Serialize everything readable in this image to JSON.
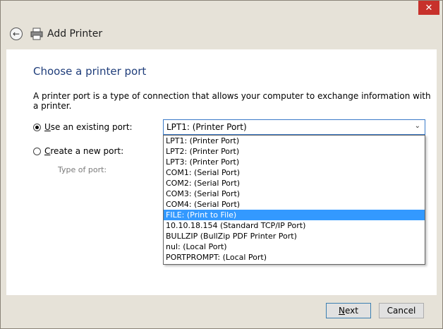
{
  "window": {
    "close_glyph": "✕"
  },
  "nav": {
    "back_glyph": "←",
    "title": "Add Printer"
  },
  "main": {
    "heading": "Choose a printer port",
    "description": "A printer port is a type of connection that allows your computer to exchange information with a printer.",
    "existing_port": {
      "label_mnemonic": "U",
      "label_rest": "se an existing port:",
      "checked": true
    },
    "new_port": {
      "label_mnemonic": "C",
      "label_rest": "reate a new port:",
      "checked": false
    },
    "type_of_port_label": "Type of port:",
    "port_combo": {
      "value": "LPT1: (Printer Port)",
      "options": [
        "LPT1: (Printer Port)",
        "LPT2: (Printer Port)",
        "LPT3: (Printer Port)",
        "COM1: (Serial Port)",
        "COM2: (Serial Port)",
        "COM3: (Serial Port)",
        "COM4: (Serial Port)",
        "FILE: (Print to File)",
        "10.10.18.154 (Standard TCP/IP Port)",
        "BULLZIP (BullZip PDF Printer Port)",
        "nul: (Local Port)",
        "PORTPROMPT: (Local Port)"
      ],
      "highlighted_index": 7
    }
  },
  "footer": {
    "next": {
      "mnemonic": "N",
      "rest": "ext"
    },
    "cancel_label": "Cancel"
  },
  "colors": {
    "accent": "#3399ff",
    "close": "#c7312b",
    "heading": "#1f3d7a"
  }
}
